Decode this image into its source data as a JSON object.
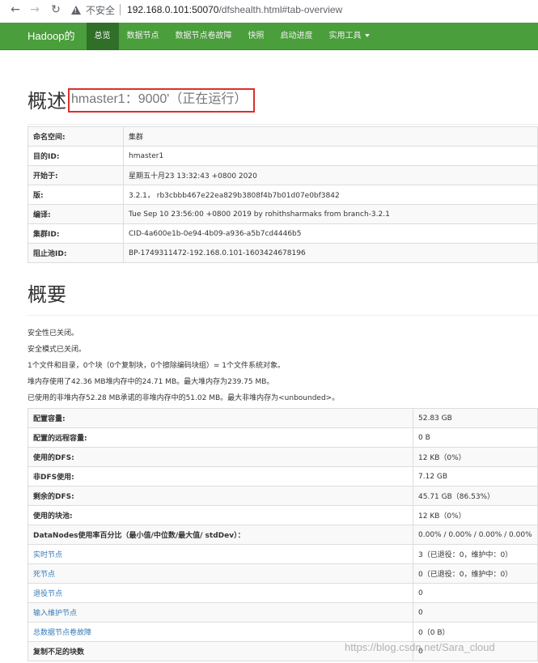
{
  "browser": {
    "insecure_label": "不安全",
    "url_host": "192.168.0.101:50070",
    "url_path": "/dfshealth.html#tab-overview"
  },
  "navbar": {
    "brand": "Hadoop的",
    "items": [
      "总览",
      "数据节点",
      "数据节点卷故障",
      "快照",
      "启动进度",
      "实用工具"
    ]
  },
  "overview": {
    "heading": "概述",
    "host_status": "hmaster1：9000'（正在运行）",
    "rows": [
      {
        "label": "命名空间:",
        "value": "集群"
      },
      {
        "label": "目的ID:",
        "value": "hmaster1"
      },
      {
        "label": "开始于:",
        "value": "星期五十月23 13:32:43 +0800 2020"
      },
      {
        "label": "版:",
        "value": "3.2.1， rb3cbbb467e22ea829b3808f4b7b01d07e0bf3842"
      },
      {
        "label": "编译:",
        "value": "Tue Sep 10 23:56:00 +0800 2019 by rohithsharmaks from branch-3.2.1"
      },
      {
        "label": "集群ID:",
        "value": "CID-4a600e1b-0e94-4b09-a936-a5b7cd4446b5"
      },
      {
        "label": "阻止池ID:",
        "value": "BP-1749311472-192.168.0.101-1603424678196"
      }
    ]
  },
  "summary": {
    "heading": "概要",
    "lines": [
      "安全性已关闭。",
      "安全模式已关闭。",
      "1个文件和目录，0个块（0个复制块，0个擦除编码块组）= 1个文件系统对象。",
      "堆内存使用了42.36 MB堆内存中的24.71 MB。最大堆内存为239.75 MB。",
      "已使用的非堆内存52.28 MB承诺的非堆内存中的51.02 MB。最大非堆内存为<unbounded>。"
    ],
    "rows": [
      {
        "label": "配置容量:",
        "value": "52.83 GB",
        "link": false
      },
      {
        "label": "配置的远程容量:",
        "value": "0 B",
        "link": false
      },
      {
        "label": "使用的DFS:",
        "value": "12 KB（0%）",
        "link": false
      },
      {
        "label": "非DFS使用:",
        "value": "7.12 GB",
        "link": false
      },
      {
        "label": "剩余的DFS:",
        "value": "45.71 GB（86.53%）",
        "link": false
      },
      {
        "label": "使用的块池:",
        "value": "12 KB（0%）",
        "link": false
      },
      {
        "label": "DataNodes使用率百分比（最小值/中位数/最大值/ stdDev）：",
        "value": "0.00% / 0.00% / 0.00% / 0.00%",
        "link": false
      },
      {
        "label": "实时节点",
        "value": "3（已退役：0，维护中：0）",
        "link": true
      },
      {
        "label": "死节点",
        "value": "0（已退役：0，维护中：0）",
        "link": true
      },
      {
        "label": "退役节点",
        "value": "0",
        "link": true
      },
      {
        "label": "输入维护节点",
        "value": "0",
        "link": true
      },
      {
        "label": "总数据节点卷故障",
        "value": "0（0 B）",
        "link": true
      },
      {
        "label": "复制不足的块数",
        "value": "0",
        "link": false
      }
    ]
  },
  "watermark": "https://blog.csdn.net/Sara_cloud"
}
